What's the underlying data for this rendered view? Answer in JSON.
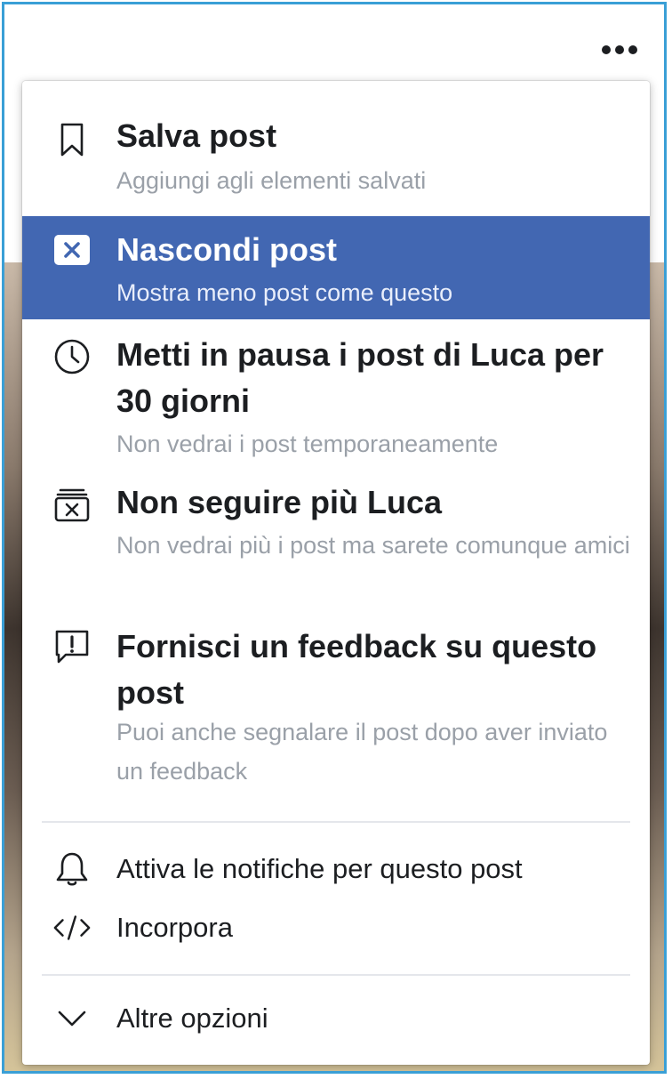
{
  "menu": {
    "items": [
      {
        "icon": "bookmark-icon",
        "title": "Salva post",
        "desc": "Aggiungi agli elementi salvati"
      },
      {
        "icon": "hide-icon",
        "title": "Nascondi post",
        "desc": "Mostra meno post come questo",
        "active": true
      },
      {
        "icon": "clock-icon",
        "title": "Metti in pausa i post di Luca per 30 giorni",
        "desc": "Non vedrai i post temporaneamente"
      },
      {
        "icon": "unfollow-icon",
        "title": "Non seguire più Luca",
        "desc": "Non vedrai più i post ma sarete comunque amici"
      },
      {
        "icon": "feedback-icon",
        "title": "Fornisci un feedback su questo post",
        "desc": "Puoi anche segnalare il post dopo aver inviato un feedback"
      }
    ],
    "secondary": [
      {
        "icon": "bell-icon",
        "label": "Attiva le notifiche per questo post"
      },
      {
        "icon": "code-icon",
        "label": "Incorpora"
      }
    ],
    "more": {
      "icon": "chevron-down-icon",
      "label": "Altre opzioni"
    }
  },
  "colors": {
    "active_bg": "#4267b2",
    "frame": "#3a9fd6",
    "text": "#1c1e21",
    "muted": "#9aa0a8"
  }
}
